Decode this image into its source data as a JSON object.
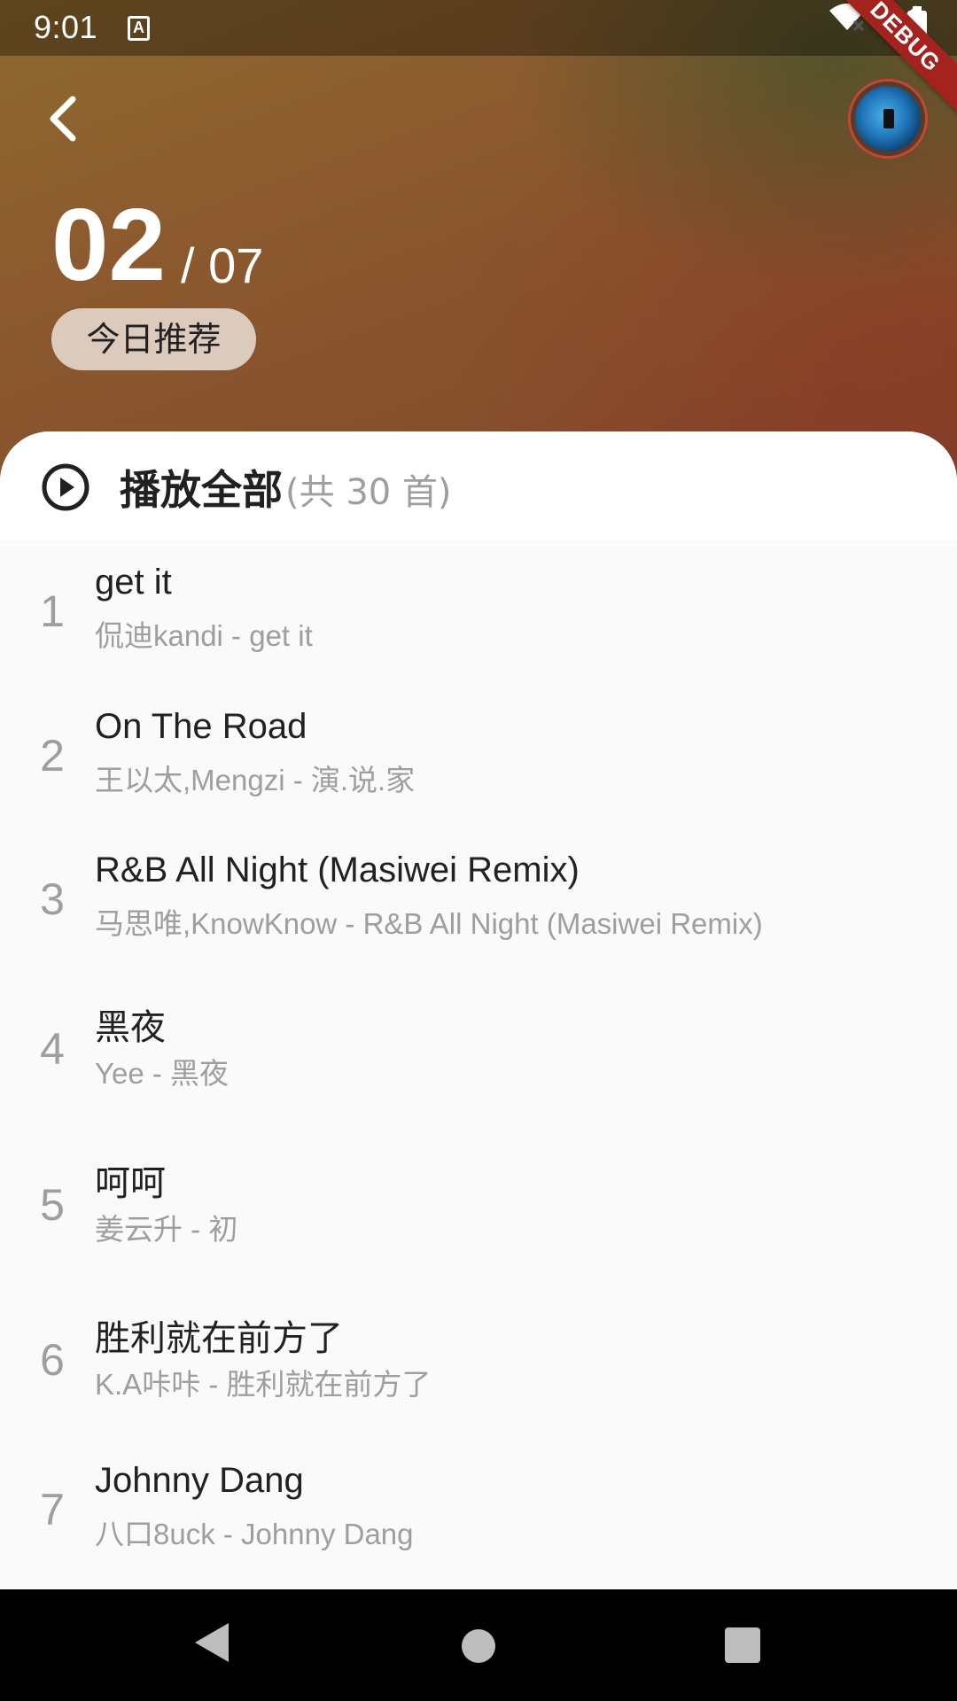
{
  "status_bar": {
    "time": "9:01",
    "a_icon_letter": "A"
  },
  "debug_banner": "DEBUG",
  "header": {
    "day": "02",
    "month_sep": "/ 07",
    "chip_label": "今日推荐"
  },
  "play_all": {
    "label": "播放全部",
    "count": "(共 30 首)"
  },
  "songs": [
    {
      "index": "1",
      "title": "get it",
      "subtitle": "侃迪kandi - get it"
    },
    {
      "index": "2",
      "title": "On The Road",
      "subtitle": "王以太,Mengzi - 演.说.家"
    },
    {
      "index": "3",
      "title": "R&B All Night (Masiwei Remix)",
      "subtitle": "马思唯,KnowKnow - R&B All Night (Masiwei Remix)"
    },
    {
      "index": "4",
      "title": "黑夜",
      "subtitle": "Yee - 黑夜"
    },
    {
      "index": "5",
      "title": "呵呵",
      "subtitle": "姜云升 - 初"
    },
    {
      "index": "6",
      "title": "胜利就在前方了",
      "subtitle": "K.A咔咔 - 胜利就在前方了"
    },
    {
      "index": "7",
      "title": "Johnny Dang",
      "subtitle": "八口8uck - Johnny Dang"
    }
  ],
  "icons": {
    "back": "back-arrow-icon",
    "play": "play-circle-icon",
    "wifi": "wifi-icon",
    "signal": "signal-icon",
    "battery": "battery-icon"
  }
}
